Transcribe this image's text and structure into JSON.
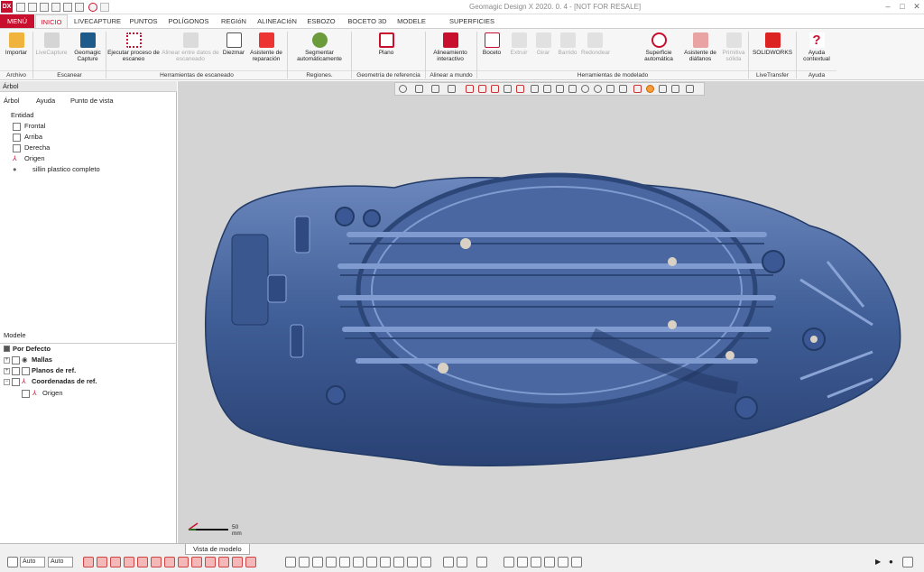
{
  "app": {
    "title": "Geomagic Design X 2020. 0. 4 - [NOT FOR RESALE]",
    "logo": "DX"
  },
  "tabs": [
    "MENÚ",
    "INICIO",
    "LIVECAPTURE",
    "PUNTOS",
    "POLÍGONOS",
    "REGIóN",
    "ALINEACIóN",
    "ESBOZO",
    "BOCETO 3D",
    "MODELE",
    "SUPERFICIES EXACTAS"
  ],
  "ribbon": {
    "buttons": [
      "Importar",
      "LiveCapture",
      "Geomagic Capture",
      "Ejecutar proceso de escaneo",
      "Alinear entre datos de escaneado",
      "Diezmar",
      "Asistente de reparación",
      "Segmentar automáticamente",
      "Plano",
      "Alineamiento interactivo",
      "Boceto",
      "Extruir",
      "Girar",
      "Barrido",
      "Redondear",
      "Superficie automática",
      "Asistente de diáfanos",
      "Primitiva sólida",
      "SOLIDWORKS",
      "Ayuda contextual"
    ],
    "groups": [
      "Archivo",
      "Escanear",
      "Herramientas de escaneado",
      "Regiones.",
      "Geometría de referencia",
      "Alinear a mundo",
      "Herramientas de modelado",
      "LiveTransfer",
      "Ayuda"
    ]
  },
  "tree": {
    "panel_title": "Árbol",
    "tabs": [
      "Árbol",
      "Ayuda",
      "Punto de vista"
    ],
    "section": "Entidad",
    "items": [
      "Frontal",
      "Arriba",
      "Derecha",
      "Origen",
      "sillin plastico completo"
    ]
  },
  "model": {
    "panel_title": "Modele",
    "root": "Por Defecto",
    "items": [
      "Mallas",
      "Planos de ref.",
      "Coordenadas de ref.",
      "Origen"
    ]
  },
  "viewport": {
    "tab_label": "Vista de modelo",
    "scale_label": "50 mm",
    "mesh_color": "#3f5d96"
  },
  "statusbar": {
    "combo1": "Auto",
    "combo2": "Auto"
  }
}
